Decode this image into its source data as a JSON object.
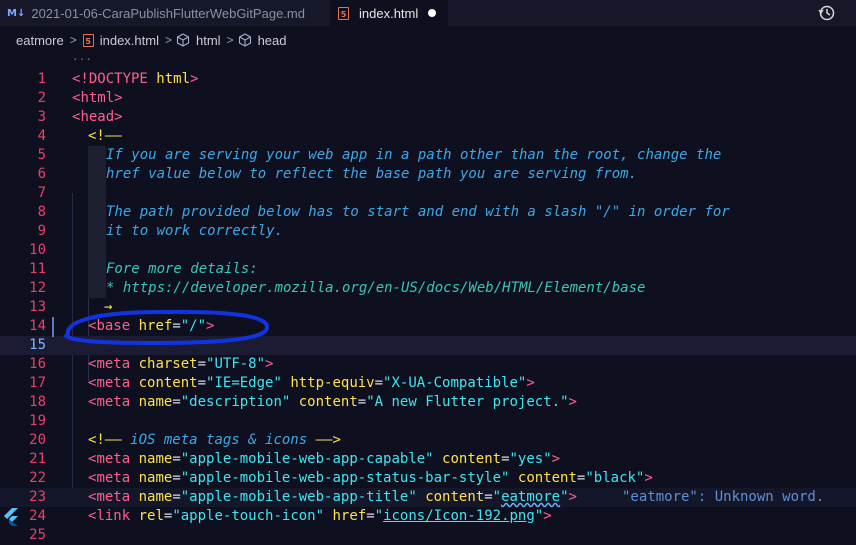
{
  "tabs": [
    {
      "icon": "M↓",
      "label": "2021-01-06-CaraPublishFlutterWebGitPage.md"
    },
    {
      "icon": "5",
      "label": "index.html",
      "modified": true
    }
  ],
  "breadcrumb": [
    "eatmore",
    "index.html",
    "html",
    "head"
  ],
  "breadcrumb_sep": ">",
  "ellipsis": "...",
  "lines": [
    {
      "n": "1"
    },
    {
      "n": "2"
    },
    {
      "n": "3"
    },
    {
      "n": "4"
    },
    {
      "n": "5"
    },
    {
      "n": "6"
    },
    {
      "n": "7"
    },
    {
      "n": "8"
    },
    {
      "n": "9"
    },
    {
      "n": "10"
    },
    {
      "n": "11"
    },
    {
      "n": "12"
    },
    {
      "n": "13"
    },
    {
      "n": "14"
    },
    {
      "n": "15"
    },
    {
      "n": "16"
    },
    {
      "n": "17"
    },
    {
      "n": "18"
    },
    {
      "n": "19"
    },
    {
      "n": "20"
    },
    {
      "n": "21"
    },
    {
      "n": "22"
    },
    {
      "n": "23"
    },
    {
      "n": "24"
    },
    {
      "n": "25"
    }
  ],
  "code": {
    "l1": [
      "<!DOCTYPE ",
      "html",
      ">"
    ],
    "l2": [
      "<",
      "html",
      ">"
    ],
    "l3": [
      "<",
      "head",
      ">"
    ],
    "l4": "<!——",
    "l5": "If you are serving your web app in a path other than the root, change the",
    "l6": "href value below to reflect the base path you are serving from.",
    "l8": "The path provided below has to start and end with a slash \"/\" in order for",
    "l9": "it to work correctly.",
    "l11": "Fore more details:",
    "l12": "* https://developer.mozilla.org/en-US/docs/Web/HTML/Element/base",
    "l13": "→",
    "l14": [
      "<",
      "base",
      " href",
      "=",
      "\"/\"",
      ">"
    ],
    "l16": [
      "<",
      "meta",
      " charset",
      "=",
      "\"UTF-8\"",
      ">"
    ],
    "l17": [
      "<",
      "meta",
      " content",
      "=",
      "\"IE=Edge\"",
      " http-equiv",
      "=",
      "\"X-UA-Compatible\"",
      ">"
    ],
    "l18": [
      "<",
      "meta",
      " name",
      "=",
      "\"description\"",
      " content",
      "=",
      "\"A new Flutter project.\"",
      ">"
    ],
    "l20a": "<!—— ",
    "l20b": "iOS meta tags & icons",
    "l20c": " ——>",
    "l21": [
      "<",
      "meta",
      " name",
      "=",
      "\"apple-mobile-web-app-capable\"",
      " content",
      "=",
      "\"yes\"",
      ">"
    ],
    "l22": [
      "<",
      "meta",
      " name",
      "=",
      "\"apple-mobile-web-app-status-bar-style\"",
      " content",
      "=",
      "\"black\"",
      ">"
    ],
    "l23": [
      "<",
      "meta",
      " name",
      "=",
      "\"apple-mobile-web-app-title\"",
      " content",
      "=",
      "\"",
      "eatmore",
      "\"",
      ">"
    ],
    "l23diag": "\"eatmore\": Unknown word.",
    "l24": [
      "<",
      "link",
      " rel",
      "=",
      "\"apple-touch-icon\"",
      " href",
      "=",
      "\"",
      "icons/Icon-192.png",
      "\"",
      ">"
    ]
  },
  "colors": {
    "tag": "#ff5f8f",
    "attr": "#ffe14a",
    "string": "#3ee6f0",
    "comment": "#3da8e8",
    "annotation": "#1433e0"
  }
}
